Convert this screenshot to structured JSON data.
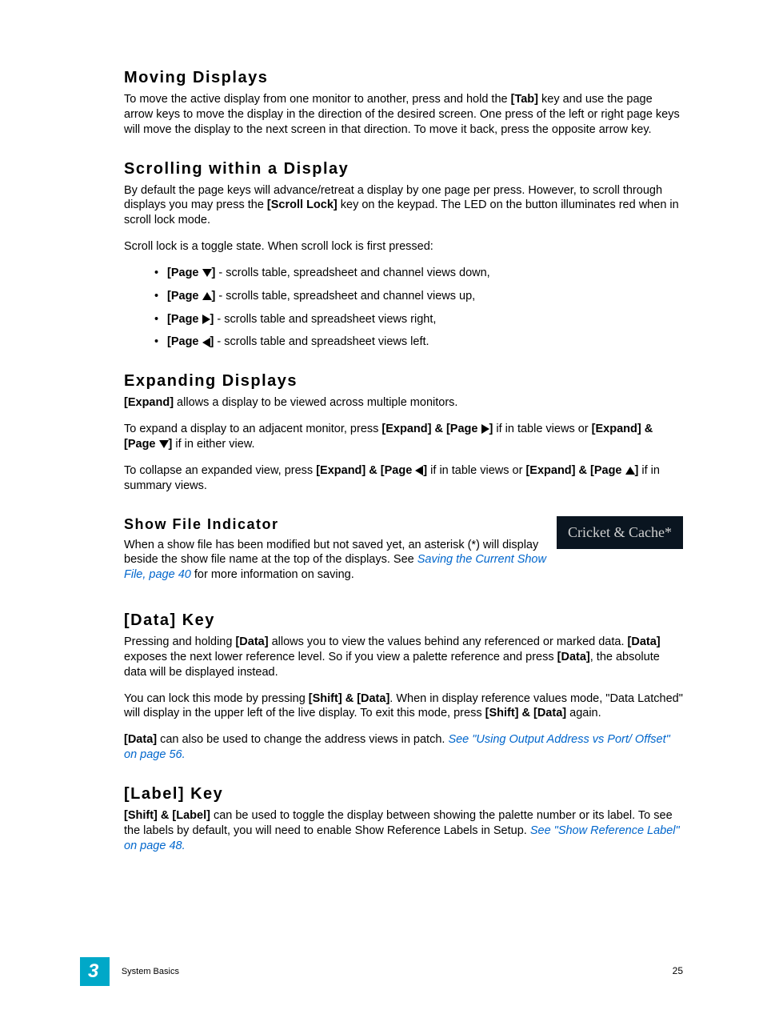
{
  "sections": {
    "moving": {
      "title": "Moving Displays",
      "p1_a": "To move the active display from one monitor to another, press and hold the ",
      "p1_key": "[Tab]",
      "p1_b": " key and use the page arrow keys to move the display in the direction of the desired screen. One press of the left or right page keys will move the display to the next screen in that direction. To move it back, press the opposite arrow key."
    },
    "scrolling": {
      "title": "Scrolling within a Display",
      "p1_a": "By default the page keys will advance/retreat a display by one page per press. However, to scroll through displays you may press the ",
      "p1_key": "[Scroll Lock]",
      "p1_b": " key on the keypad. The LED on the button illuminates red when in scroll lock mode.",
      "p2": "Scroll lock is a toggle state. When scroll lock is first pressed:",
      "items": [
        {
          "label": "[Page ",
          "after": "]",
          "desc": " - scrolls table, spreadsheet and channel views down,"
        },
        {
          "label": "[Page ",
          "after": "]",
          "desc": " - scrolls table, spreadsheet and channel views up,"
        },
        {
          "label": "[Page ",
          "after": "]",
          "desc": " - scrolls table and spreadsheet views right,"
        },
        {
          "label": "[Page ",
          "after": "]",
          "desc": " - scrolls table and spreadsheet views left."
        }
      ]
    },
    "expanding": {
      "title": "Expanding Displays",
      "p1_key": "[Expand]",
      "p1_b": " allows a display to be viewed across multiple monitors.",
      "p2_a": "To expand a display to an adjacent monitor, press ",
      "p2_k1": "[Expand] & [Page ",
      "p2_k1b": "]",
      "p2_mid": " if in table views or ",
      "p2_k2": "[Expand] & [Page ",
      "p2_k2b": "]",
      "p2_end": " if in either view.",
      "p3_a": "To collapse an expanded view, press ",
      "p3_k1": "[Expand] & [Page ",
      "p3_k1b": "]",
      "p3_mid": " if in table views or ",
      "p3_k2": "[Expand] & [Page ",
      "p3_k2b": "]",
      "p3_end": " if in summary views."
    },
    "showfile": {
      "title": "Show File Indicator",
      "badge": "Cricket & Cache*",
      "p1_a": "When a show file has been modified but not saved yet, an asterisk (*) will display beside the show file name at the top of the displays. See ",
      "link": "Saving the Current Show File, page 40",
      "p1_b": " for more information on saving."
    },
    "datakey": {
      "title": "[Data] Key",
      "p1_a": "Pressing and holding ",
      "p1_k1": "[Data]",
      "p1_b": " allows you to view the values behind any referenced or marked data. ",
      "p1_k2": "[Data]",
      "p1_c": " exposes the next lower reference level. So if you view a palette reference and press ",
      "p1_k3": "[Data]",
      "p1_d": ", the absolute data will be displayed instead.",
      "p2_a": "You can lock this mode by pressing ",
      "p2_k1": "[Shift] & [Data]",
      "p2_b": ". When in display reference values mode, \"Data Latched\" will display in the upper left of the live display. To exit this mode, press ",
      "p2_k2": "[Shift] & [Data]",
      "p2_c": " again.",
      "p3_k": "[Data]",
      "p3_a": " can also be used to change the address views in patch. ",
      "p3_link": "See \"Using Output Address vs Port/ Offset\" on page 56."
    },
    "labelkey": {
      "title": "[Label] Key",
      "p1_k": "[Shift] & [Label]",
      "p1_a": " can be used to toggle the display between showing the palette number or its label. To see the labels by default, you will need to enable Show Reference Labels in Setup. ",
      "p1_link": "See \"Show Reference Label\" on page 48."
    }
  },
  "footer": {
    "chapter": "3",
    "chapter_title": "System Basics",
    "page_number": "25"
  }
}
